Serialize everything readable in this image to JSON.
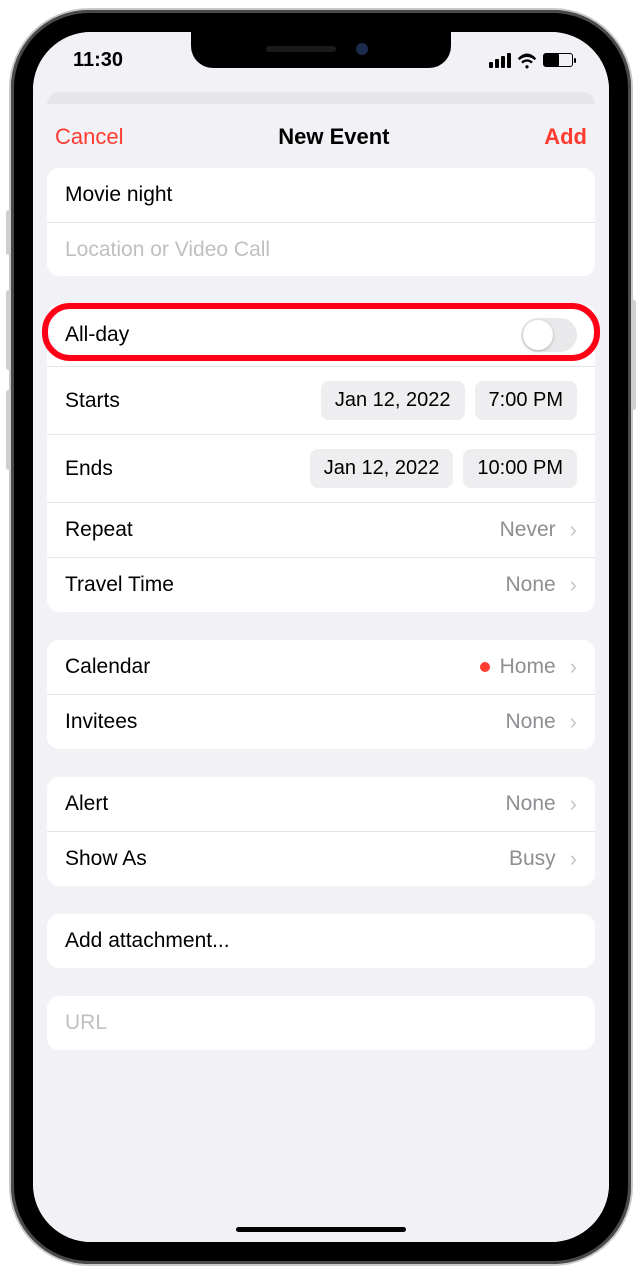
{
  "status": {
    "time": "11:30"
  },
  "nav": {
    "cancel": "Cancel",
    "title": "New Event",
    "add": "Add"
  },
  "event": {
    "title": "Movie night",
    "location_placeholder": "Location or Video Call",
    "allday_label": "All-day",
    "starts_label": "Starts",
    "starts_date": "Jan 12, 2022",
    "starts_time": "7:00 PM",
    "ends_label": "Ends",
    "ends_date": "Jan 12, 2022",
    "ends_time": "10:00 PM",
    "repeat_label": "Repeat",
    "repeat_value": "Never",
    "travel_label": "Travel Time",
    "travel_value": "None",
    "calendar_label": "Calendar",
    "calendar_value": "Home",
    "invitees_label": "Invitees",
    "invitees_value": "None",
    "alert_label": "Alert",
    "alert_value": "None",
    "showas_label": "Show As",
    "showas_value": "Busy",
    "attachment_label": "Add attachment...",
    "url_placeholder": "URL"
  }
}
